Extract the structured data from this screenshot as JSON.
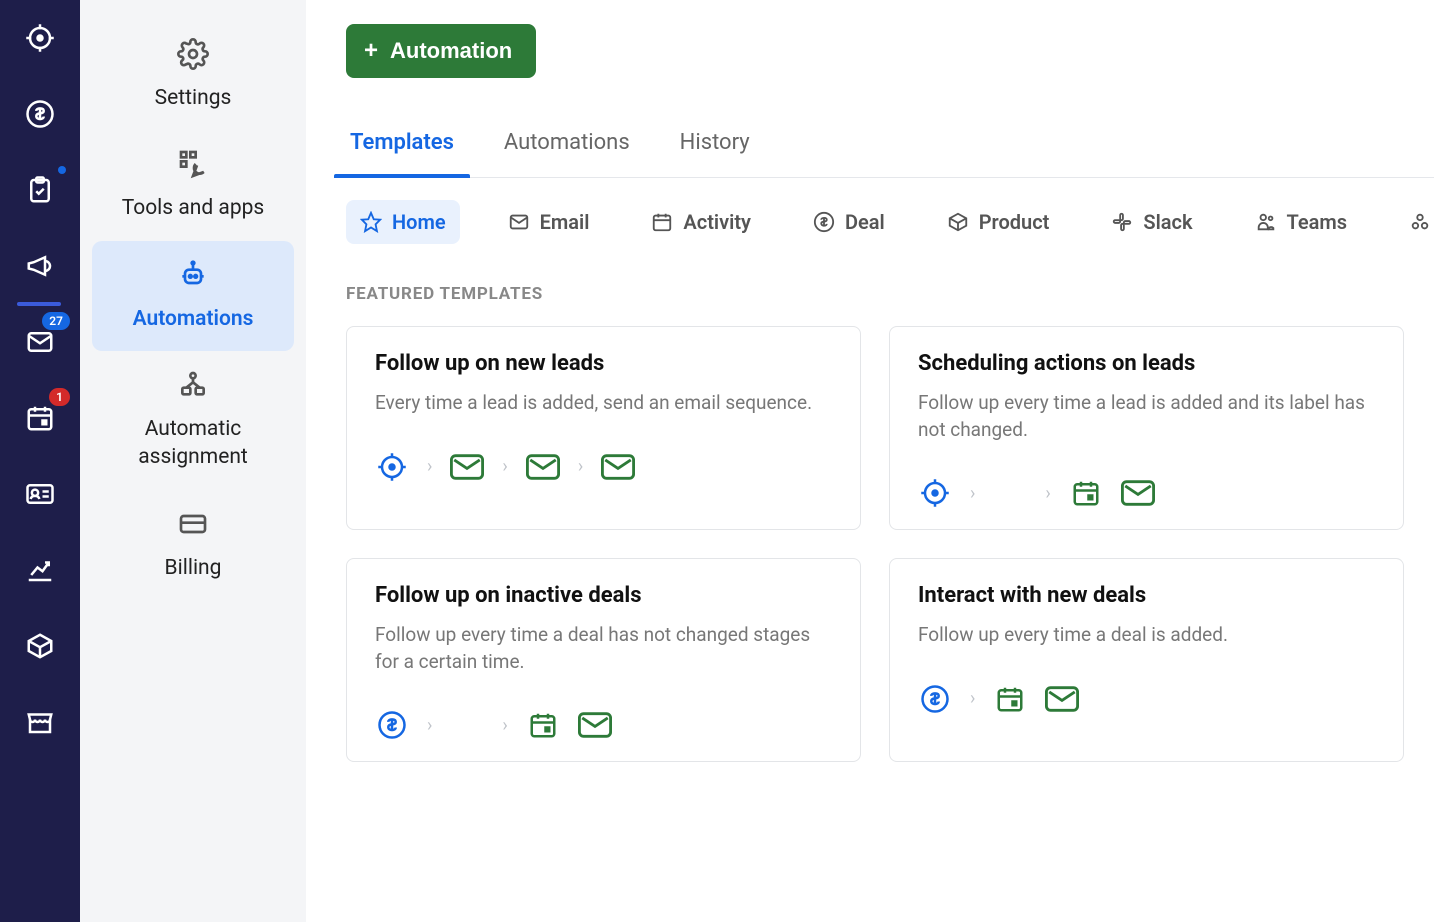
{
  "rail": {
    "badges": {
      "mail": "27",
      "calendar": "1"
    }
  },
  "sidebar": {
    "items": [
      {
        "label": "Settings"
      },
      {
        "label": "Tools and apps"
      },
      {
        "label": "Automations"
      },
      {
        "label": "Automatic assignment"
      },
      {
        "label": "Billing"
      }
    ]
  },
  "main": {
    "primary_button": "Automation",
    "tabs": [
      {
        "label": "Templates"
      },
      {
        "label": "Automations"
      },
      {
        "label": "History"
      }
    ],
    "filters": [
      {
        "label": "Home"
      },
      {
        "label": "Email"
      },
      {
        "label": "Activity"
      },
      {
        "label": "Deal"
      },
      {
        "label": "Product"
      },
      {
        "label": "Slack"
      },
      {
        "label": "Teams"
      },
      {
        "label": "Asana"
      }
    ],
    "section_title": "FEATURED TEMPLATES",
    "cards": [
      {
        "title": "Follow up on new leads",
        "desc": "Every time a lead is added, send an email sequence."
      },
      {
        "title": "Scheduling actions on leads",
        "desc": "Follow up every time a lead is added and its label has not changed."
      },
      {
        "title": "Follow up on inactive deals",
        "desc": "Follow up every time a deal has not changed stages for a certain time."
      },
      {
        "title": "Interact with new deals",
        "desc": "Follow up every time a deal is added."
      }
    ]
  }
}
